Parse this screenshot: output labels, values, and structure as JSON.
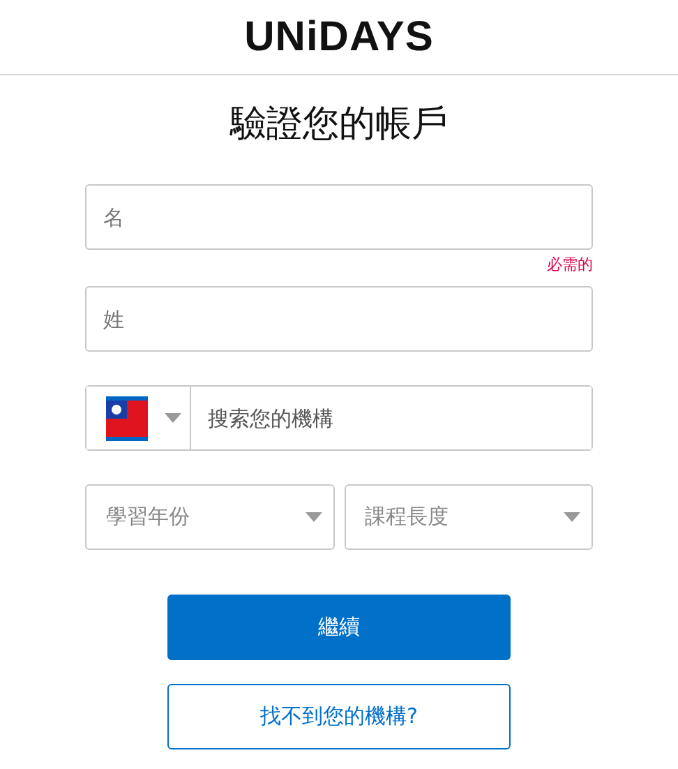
{
  "header": {
    "logo": "UNiDAYS"
  },
  "title": "驗證您的帳戶",
  "first_name": {
    "placeholder": "名",
    "error": "必需的"
  },
  "last_name": {
    "placeholder": "姓"
  },
  "institution": {
    "placeholder": "搜索您的機構"
  },
  "selects": [
    {
      "placeholder": "學習年份"
    },
    {
      "placeholder": "課程長度"
    }
  ],
  "buttons": [
    {
      "label": "繼續",
      "kind": "primary"
    },
    {
      "label": "找不到您的機構?",
      "kind": "secondary"
    }
  ]
}
